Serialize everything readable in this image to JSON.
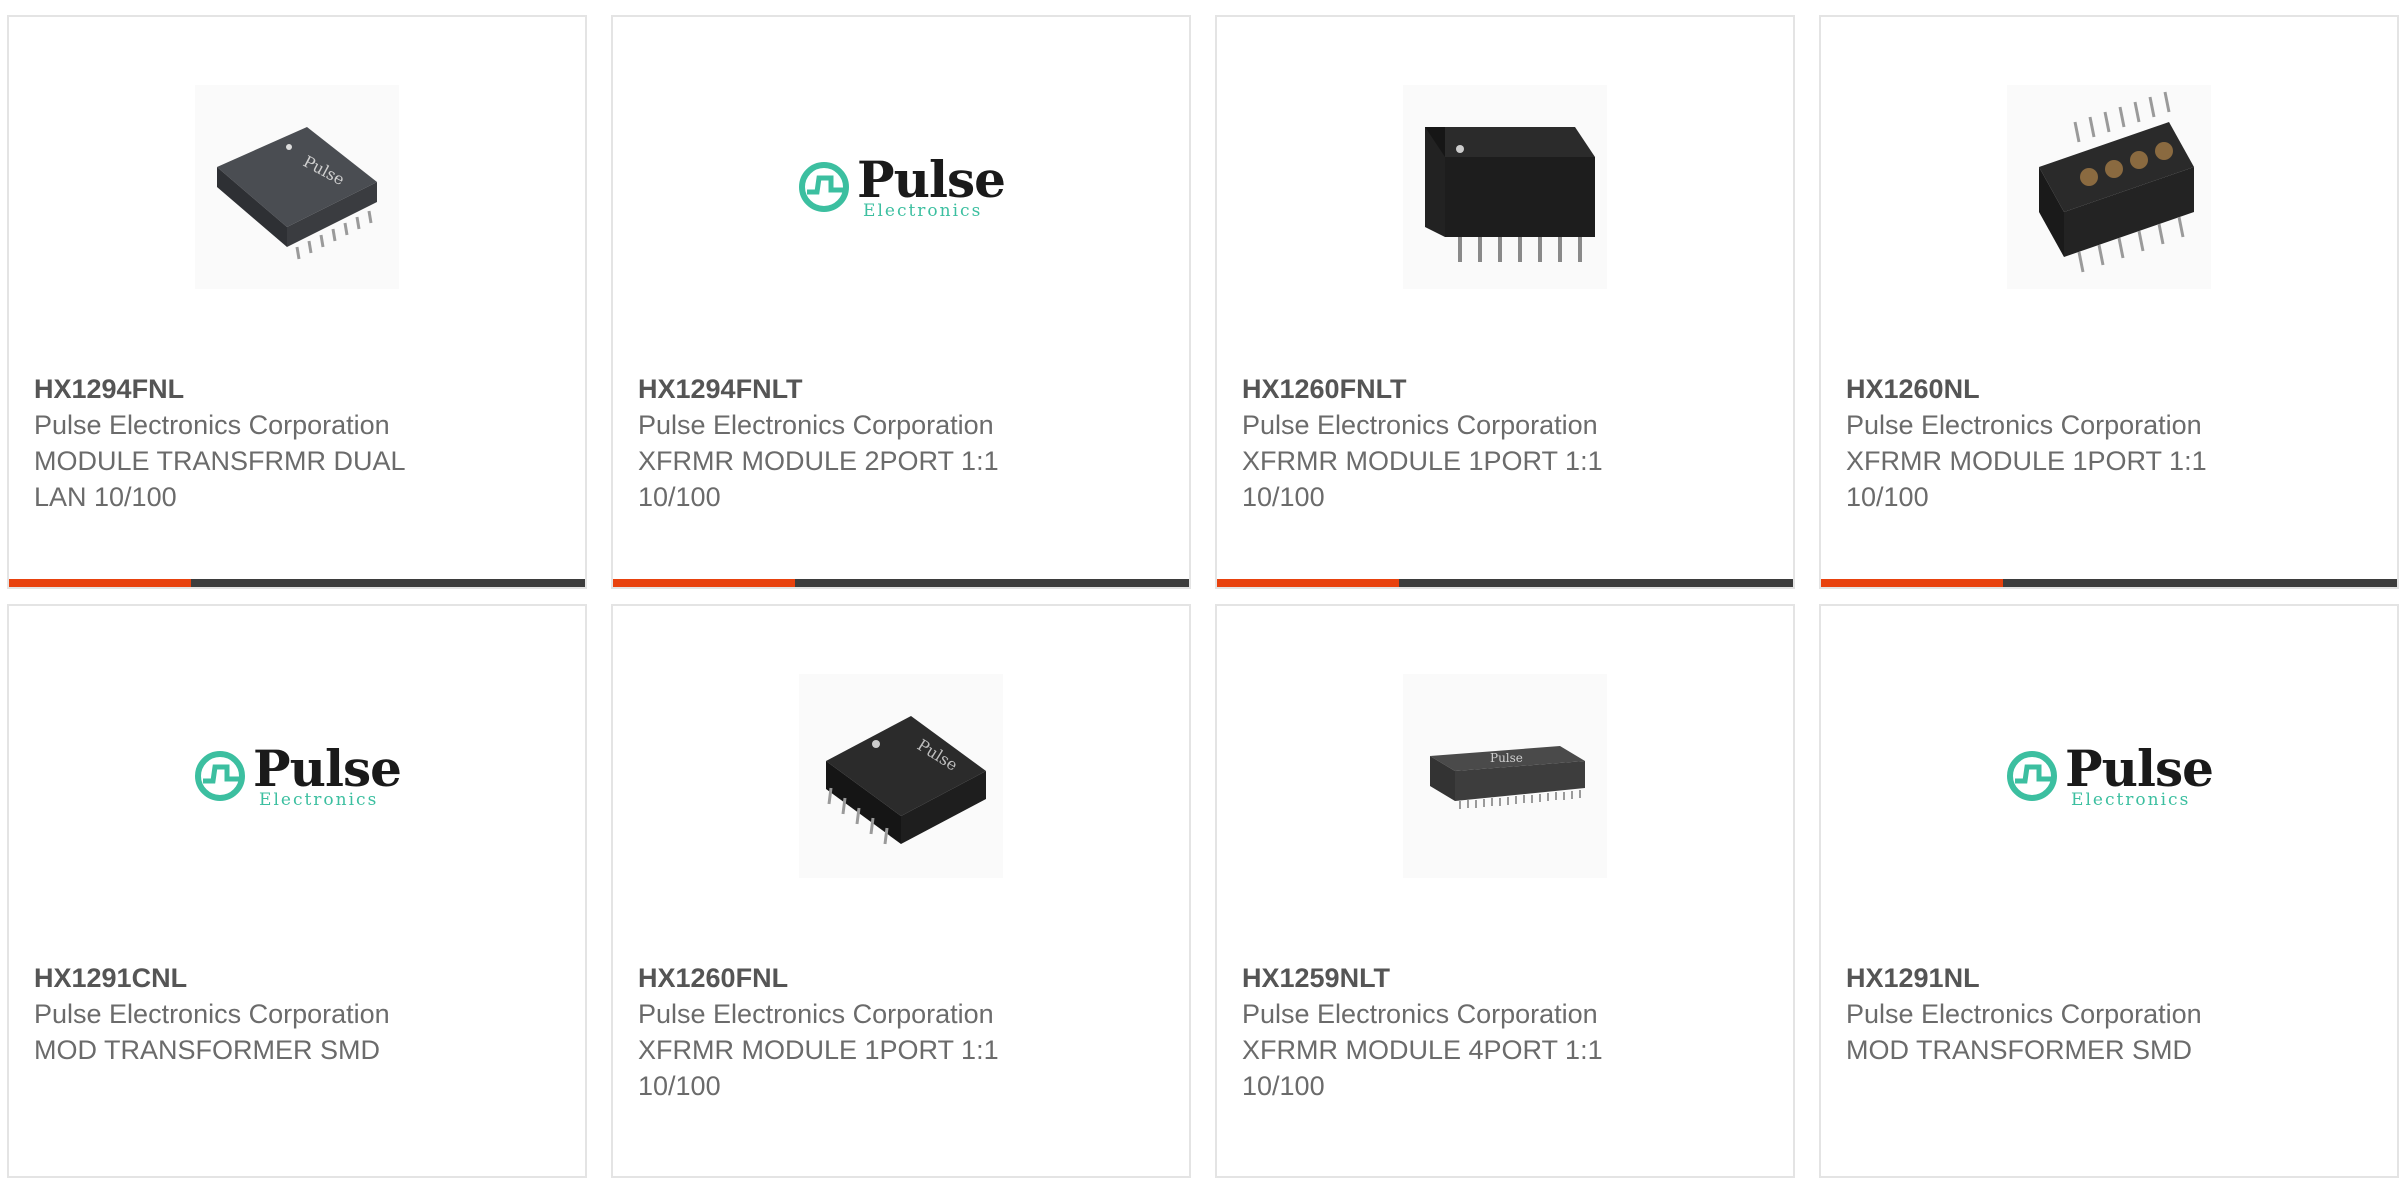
{
  "products": [
    {
      "part_number": "HX1294FNL",
      "manufacturer": "Pulse Electronics Corporation",
      "description": "MODULE TRANSFRMR DUAL LAN 10/100",
      "image": "transformer-module-chip-icon"
    },
    {
      "part_number": "HX1294FNLT",
      "manufacturer": "Pulse Electronics Corporation",
      "description": "XFRMR MODULE 2PORT 1:1 10/100",
      "image": "pulse-electronics-logo"
    },
    {
      "part_number": "HX1260FNLT",
      "manufacturer": "Pulse Electronics Corporation",
      "description": "XFRMR MODULE 1PORT 1:1 10/100",
      "image": "transformer-module-chip-icon"
    },
    {
      "part_number": "HX1260NL",
      "manufacturer": "Pulse Electronics Corporation",
      "description": "XFRMR MODULE 1PORT 1:1 10/100",
      "image": "open-transformer-chip-icon"
    },
    {
      "part_number": "HX1291CNL",
      "manufacturer": "Pulse Electronics Corporation",
      "description": "MOD TRANSFORMER SMD",
      "image": "pulse-electronics-logo"
    },
    {
      "part_number": "HX1260FNL",
      "manufacturer": "Pulse Electronics Corporation",
      "description": "XFRMR MODULE 1PORT 1:1 10/100",
      "image": "transformer-module-chip-icon"
    },
    {
      "part_number": "HX1259NLT",
      "manufacturer": "Pulse Electronics Corporation",
      "description": "XFRMR MODULE 4PORT 1:1 10/100",
      "image": "long-transformer-chip-icon"
    },
    {
      "part_number": "HX1291NL",
      "manufacturer": "Pulse Electronics Corporation",
      "description": "MOD TRANSFORMER SMD",
      "image": "pulse-electronics-logo"
    }
  ],
  "logo": {
    "brand": "Pulse",
    "sub": "Electronics"
  },
  "colors": {
    "accent": "#e8420e",
    "bar": "#3d3d3d",
    "logo_teal": "#3cbfa0"
  }
}
